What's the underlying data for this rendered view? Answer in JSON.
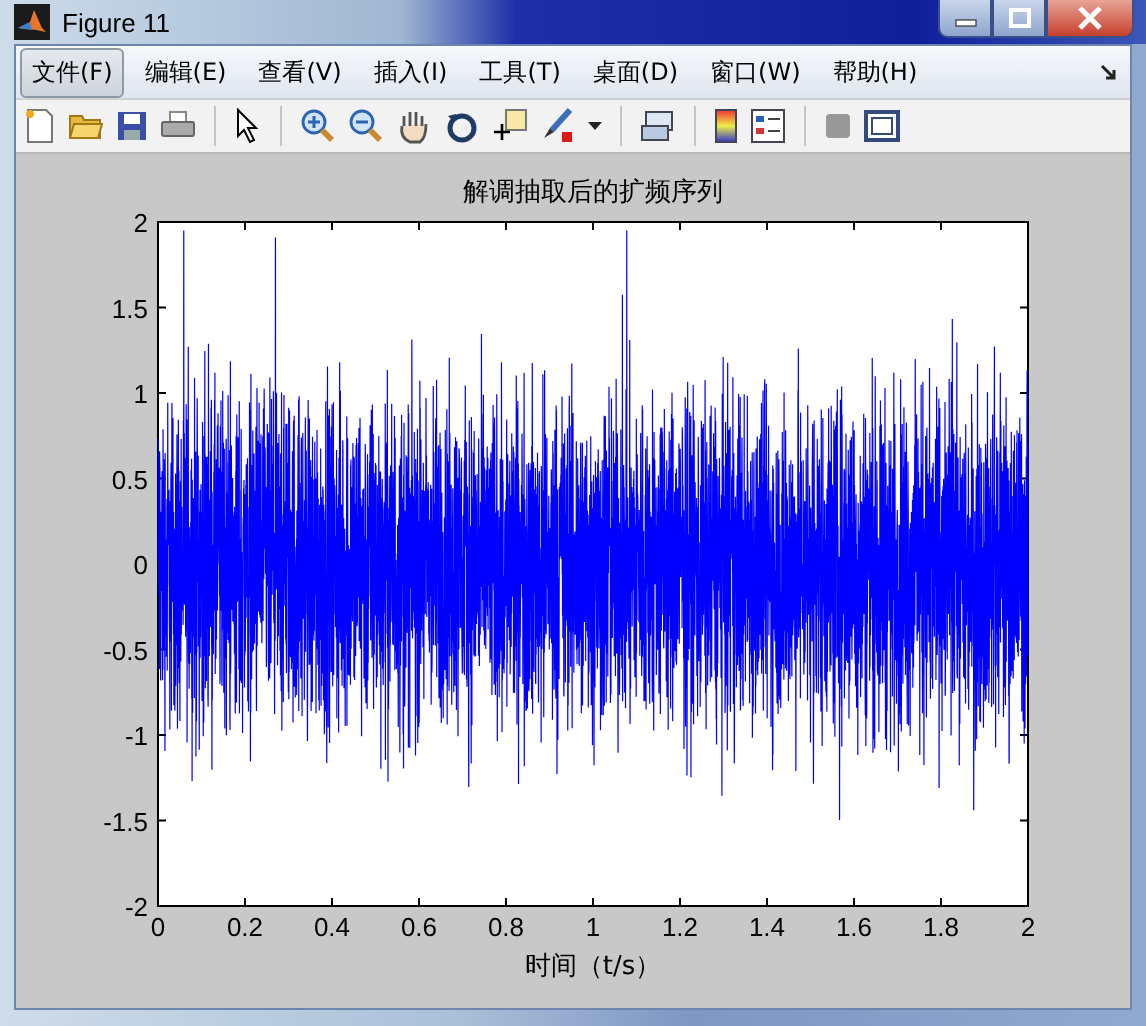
{
  "window": {
    "title": "Figure 11"
  },
  "menu": [
    {
      "label": "文件(F)",
      "selected": true
    },
    {
      "label": "编辑(E)",
      "selected": false
    },
    {
      "label": "查看(V)",
      "selected": false
    },
    {
      "label": "插入(I)",
      "selected": false
    },
    {
      "label": "工具(T)",
      "selected": false
    },
    {
      "label": "桌面(D)",
      "selected": false
    },
    {
      "label": "窗口(W)",
      "selected": false
    },
    {
      "label": "帮助(H)",
      "selected": false
    }
  ],
  "plot": {
    "title": "解调抽取后的扩频序列",
    "xlabel": "时间（t/s）",
    "x_ticks": [
      "0",
      "0.2",
      "0.4",
      "0.6",
      "0.8",
      "1",
      "1.2",
      "1.4",
      "1.6",
      "1.8",
      "2"
    ],
    "y_ticks": [
      "2",
      "1.5",
      "1",
      "0.5",
      "0",
      "-0.5",
      "-1",
      "-1.5",
      "-2"
    ]
  }
}
